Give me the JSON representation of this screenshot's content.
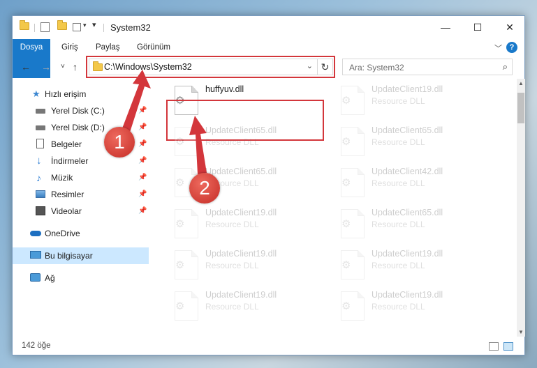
{
  "window": {
    "title": "System32"
  },
  "window_controls": {
    "minimize": "—",
    "maximize": "☐",
    "close": "✕"
  },
  "ribbon": {
    "tabs": [
      "Dosya",
      "Giriş",
      "Paylaş",
      "Görünüm"
    ],
    "help": "?",
    "file_tab_color": "#1979ca"
  },
  "navigation": {
    "back": "←",
    "forward": "→",
    "recent": "˅",
    "up": "↑",
    "address": "C:\\Windows\\System32",
    "search_placeholder": "Ara: System32"
  },
  "sidebar": {
    "items": [
      {
        "label": "Hızlı erişim",
        "icon": "star-icon",
        "pinned": false
      },
      {
        "label": "Yerel Disk (C:)",
        "icon": "drive-icon",
        "pinned": true
      },
      {
        "label": "Yerel Disk (D:)",
        "icon": "drive-icon",
        "pinned": true
      },
      {
        "label": "Belgeler",
        "icon": "documents-icon",
        "pinned": true
      },
      {
        "label": "İndirmeler",
        "icon": "download-icon",
        "pinned": true
      },
      {
        "label": "Müzik",
        "icon": "music-icon",
        "pinned": true
      },
      {
        "label": "Resimler",
        "icon": "pictures-icon",
        "pinned": true
      },
      {
        "label": "Videolar",
        "icon": "videos-icon",
        "pinned": true
      },
      {
        "label": "OneDrive",
        "icon": "cloud-icon",
        "pinned": false
      },
      {
        "label": "Bu bilgisayar",
        "icon": "computer-icon",
        "pinned": false,
        "selected": true
      },
      {
        "label": "Ağ",
        "icon": "network-icon",
        "pinned": false
      }
    ]
  },
  "files": [
    {
      "name": "huffyuv.dll",
      "type": "",
      "highlighted": true
    },
    {
      "name": "UpdateClient19.dll",
      "type": "Resource DLL"
    },
    {
      "name": "UpdateClient65.dll",
      "type": "Resource DLL"
    },
    {
      "name": "UpdateClient65.dll",
      "type": "Resource DLL"
    },
    {
      "name": "UpdateClient65.dll",
      "type": "Resource DLL"
    },
    {
      "name": "UpdateClient42.dll",
      "type": "Resource DLL"
    },
    {
      "name": "UpdateClient19.dll",
      "type": "Resource DLL"
    },
    {
      "name": "UpdateClient65.dll",
      "type": "Resource DLL"
    },
    {
      "name": "UpdateClient19.dll",
      "type": "Resource DLL"
    },
    {
      "name": "UpdateClient19.dll",
      "type": "Resource DLL"
    },
    {
      "name": "UpdateClient19.dll",
      "type": "Resource DLL"
    },
    {
      "name": "UpdateClient19.dll",
      "type": "Resource DLL"
    }
  ],
  "status": {
    "item_count": "142 öğe"
  },
  "annotations": {
    "callout_1": "1",
    "callout_2": "2",
    "color": "#d3363b"
  }
}
